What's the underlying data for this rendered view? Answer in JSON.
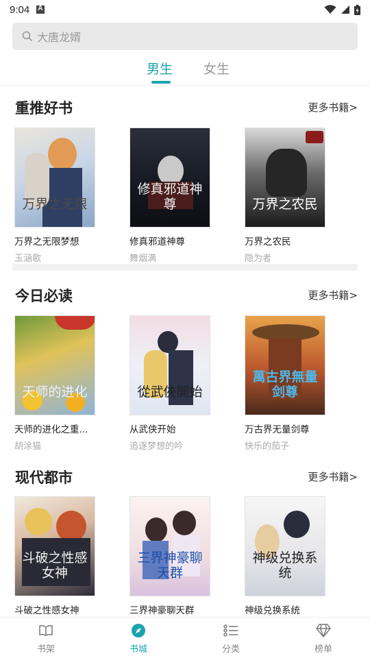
{
  "status": {
    "time": "9:04"
  },
  "search": {
    "placeholder": "大唐龙婿"
  },
  "tabs": [
    {
      "label": "男生",
      "active": true
    },
    {
      "label": "女生",
      "active": false
    }
  ],
  "colors": {
    "accent": "#1aa3ad"
  },
  "sections": [
    {
      "title": "重推好书",
      "more": "更多书籍>",
      "books": [
        {
          "title": "万界之无限梦想",
          "author": "玉涵歌",
          "cover_text": "万界之无限"
        },
        {
          "title": "修真邪道神尊",
          "author": "舞烟满",
          "cover_text": "修真邪道神尊"
        },
        {
          "title": "万界之农民",
          "author": "隐为者",
          "cover_text": "万界之农民"
        }
      ]
    },
    {
      "title": "今日必读",
      "more": "更多书籍>",
      "books": [
        {
          "title": "天师的进化之重...",
          "author": "胡涂猫",
          "cover_text": "天师的进化"
        },
        {
          "title": "从武侠开始",
          "author": "追逐梦想的吟",
          "cover_text": "從武俠開始"
        },
        {
          "title": "万古界无量剑尊",
          "author": "快乐的茄子",
          "cover_text": "萬古界無量剑尊"
        }
      ]
    },
    {
      "title": "现代都市",
      "more": "更多书籍>",
      "books": [
        {
          "title": "斗破之性感女神",
          "author": "",
          "cover_text": "斗破之性感女神"
        },
        {
          "title": "三界神豪聊天群",
          "author": "",
          "cover_text": "三界神豪聊天群"
        },
        {
          "title": "神级兑换系统",
          "author": "",
          "cover_text": "神级兑换系统"
        }
      ]
    }
  ],
  "bottom_nav": [
    {
      "label": "书架",
      "icon": "book-open-icon",
      "active": false
    },
    {
      "label": "书城",
      "icon": "compass-icon",
      "active": true
    },
    {
      "label": "分类",
      "icon": "list-icon",
      "active": false
    },
    {
      "label": "榜单",
      "icon": "diamond-icon",
      "active": false
    }
  ]
}
